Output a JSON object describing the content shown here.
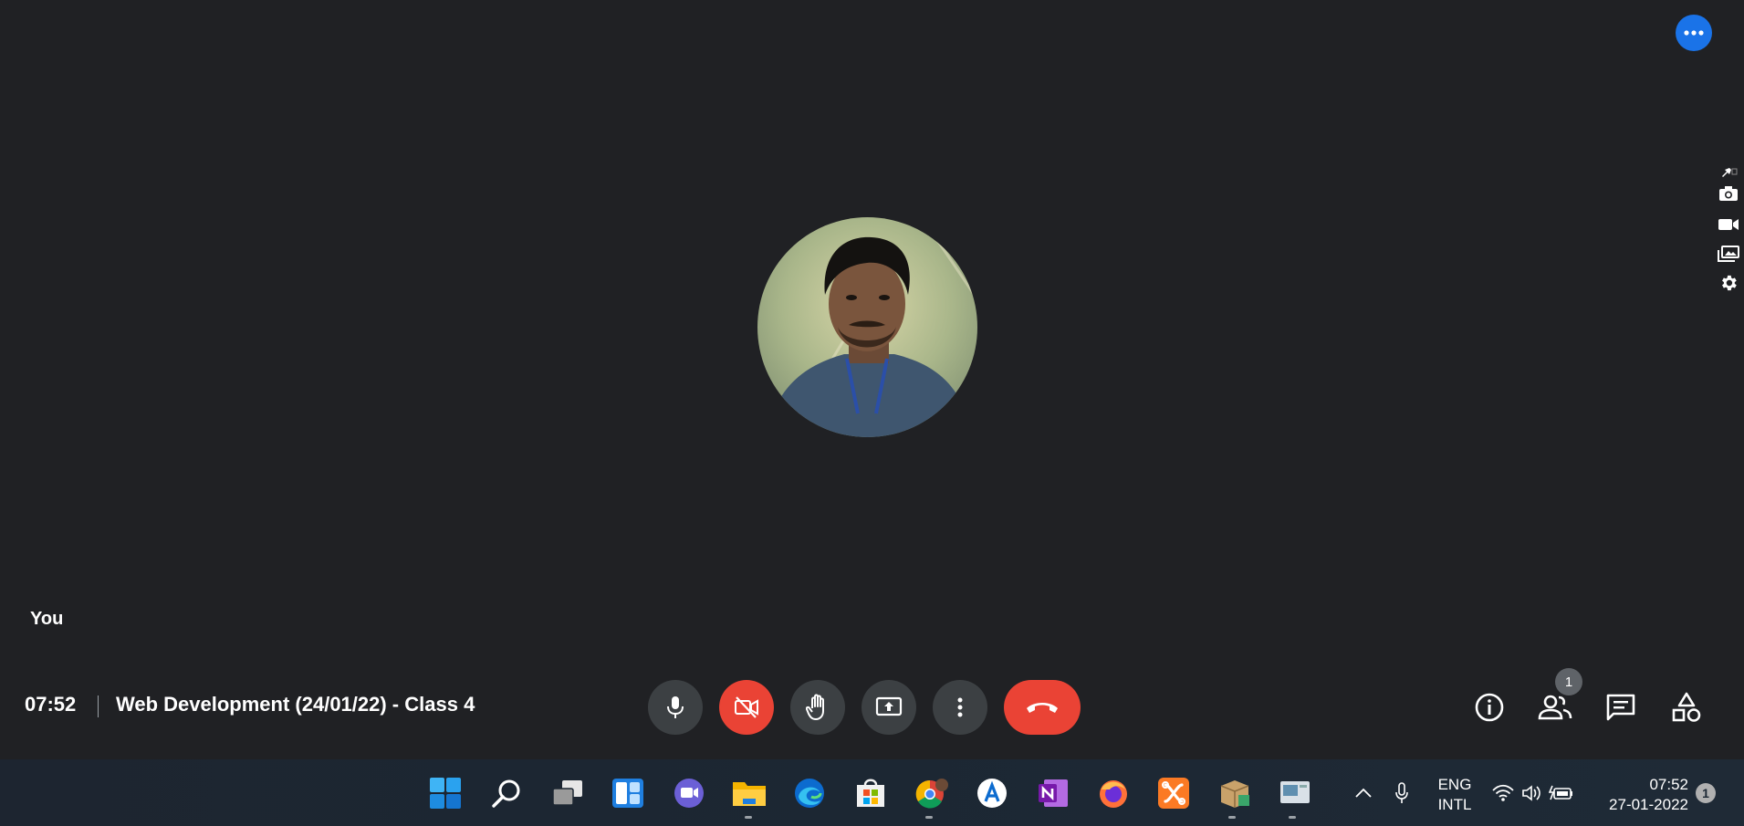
{
  "meeting": {
    "time": "07:52",
    "title": "Web Development (24/01/22) - Class 4",
    "self_label": "You",
    "people_count": "1"
  },
  "controls": {
    "mic": "mic-icon",
    "camera": "camera-off-icon",
    "raise_hand": "raise-hand-icon",
    "present": "present-screen-icon",
    "more": "more-options-icon",
    "leave": "end-call-icon"
  },
  "right_controls": [
    "info-icon",
    "people-icon",
    "chat-icon",
    "activities-icon"
  ],
  "side_tools": [
    "pin-icon",
    "camera-icon",
    "video-icon",
    "gallery-icon",
    "gear-icon"
  ],
  "taskbar": {
    "apps": [
      "start",
      "search",
      "task-view",
      "widgets",
      "teams-chat",
      "file-explorer",
      "edge",
      "microsoft-store",
      "chrome",
      "app-a",
      "onenote",
      "firefox",
      "xampp",
      "package",
      "screen-app"
    ],
    "language_line1": "ENG",
    "language_line2": "INTL",
    "clock_time": "07:52",
    "clock_date": "27-01-2022",
    "notifications": "1"
  },
  "colors": {
    "background": "#202124",
    "control_gray": "#3c4043",
    "danger": "#ea4335",
    "accent": "#1a73e8"
  }
}
